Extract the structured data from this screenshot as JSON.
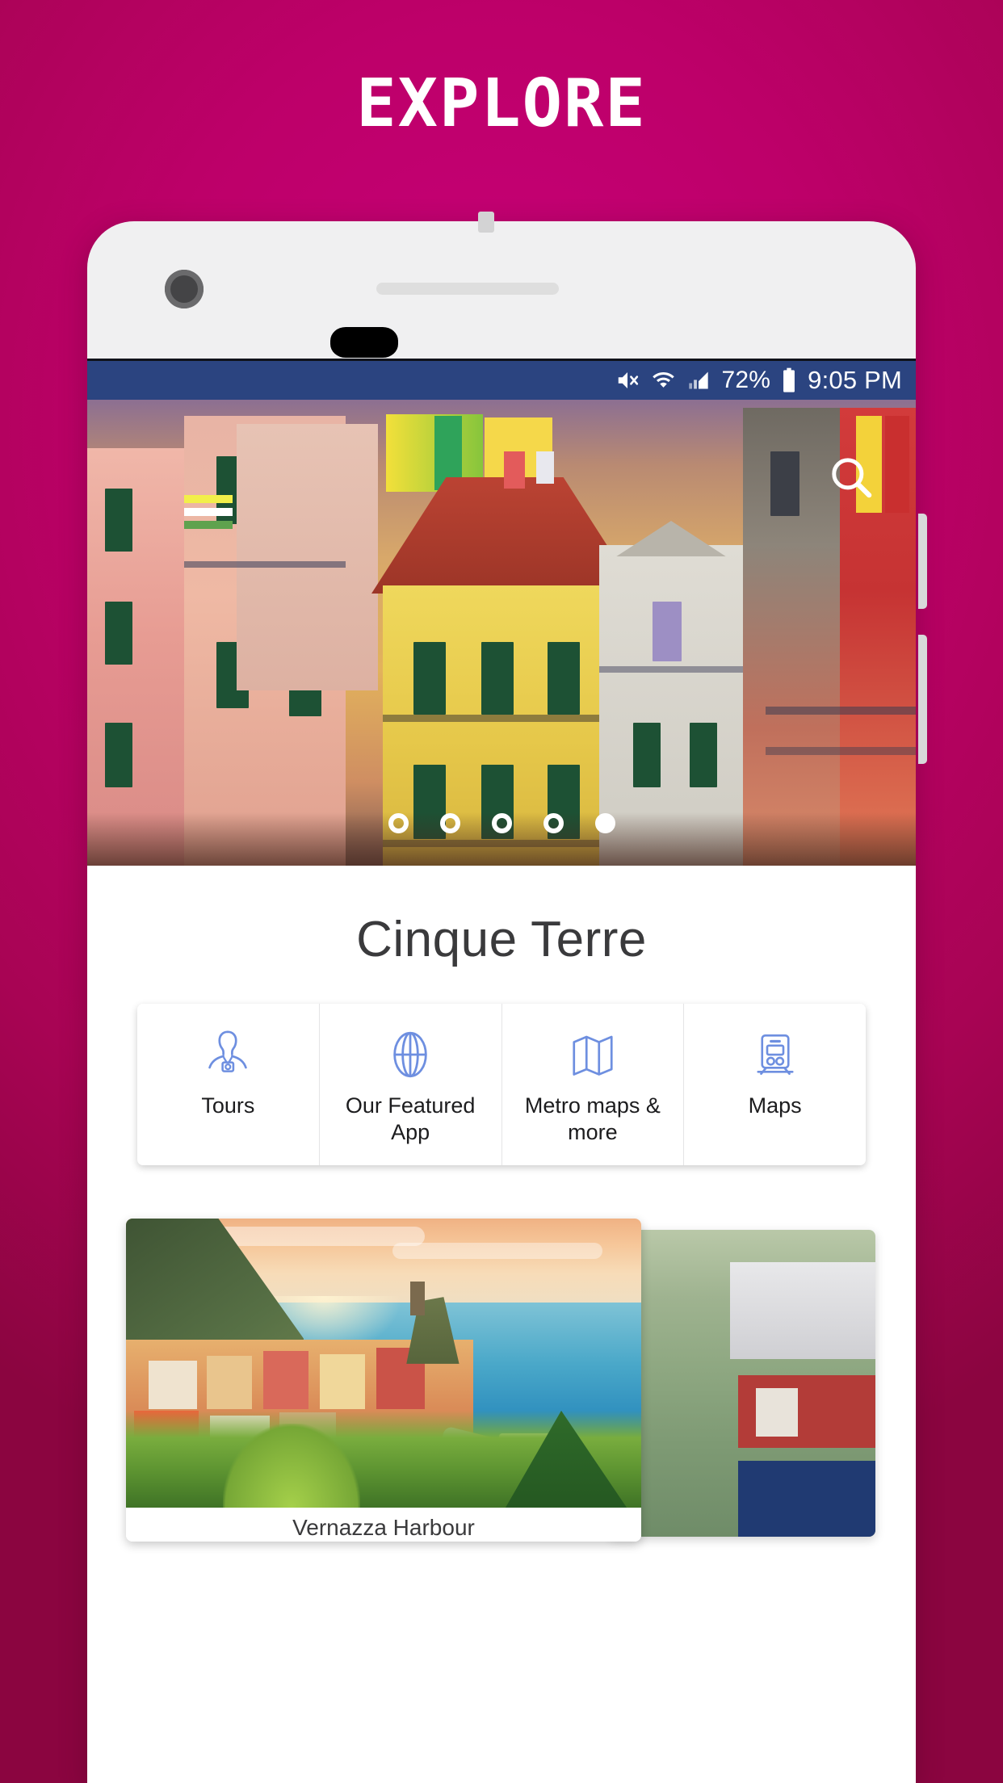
{
  "promo": {
    "headline": "EXPLORE",
    "background_start": "#c8007a",
    "background_end": "#8b0540"
  },
  "device": {
    "body_color": "#f0f0f1",
    "camera_icon": "camera-lens",
    "speaker_icon": "earpiece-speaker",
    "sensor_icon": "proximity-sensor"
  },
  "statusbar": {
    "background": "#2b4480",
    "mute_icon": "volume-mute-icon",
    "wifi_icon": "wifi-icon",
    "signal_icon": "cellular-signal-icon",
    "battery_percent": "72%",
    "battery_icon": "battery-icon",
    "time": "9:05 PM"
  },
  "hero": {
    "search_icon": "search-icon",
    "alt": "Colorful Cinque Terre village houses",
    "dots": [
      {
        "active": false
      },
      {
        "active": false
      },
      {
        "active": false
      },
      {
        "active": false
      },
      {
        "active": true
      }
    ]
  },
  "screen": {
    "title": "Cinque Terre",
    "accent": "#6e8fe0",
    "actions": [
      {
        "label": "Tours",
        "icon": "tour-guide-icon"
      },
      {
        "label": "Our Featured App",
        "icon": "globe-icon"
      },
      {
        "label": "Metro maps & more",
        "icon": "folded-map-icon"
      },
      {
        "label": "Maps",
        "icon": "train-icon"
      }
    ],
    "cards": [
      {
        "caption": "Vernazza Harbour",
        "alt": "Vernazza harbour at sunset"
      },
      {
        "caption": "",
        "alt": "Next destination photo"
      }
    ]
  }
}
